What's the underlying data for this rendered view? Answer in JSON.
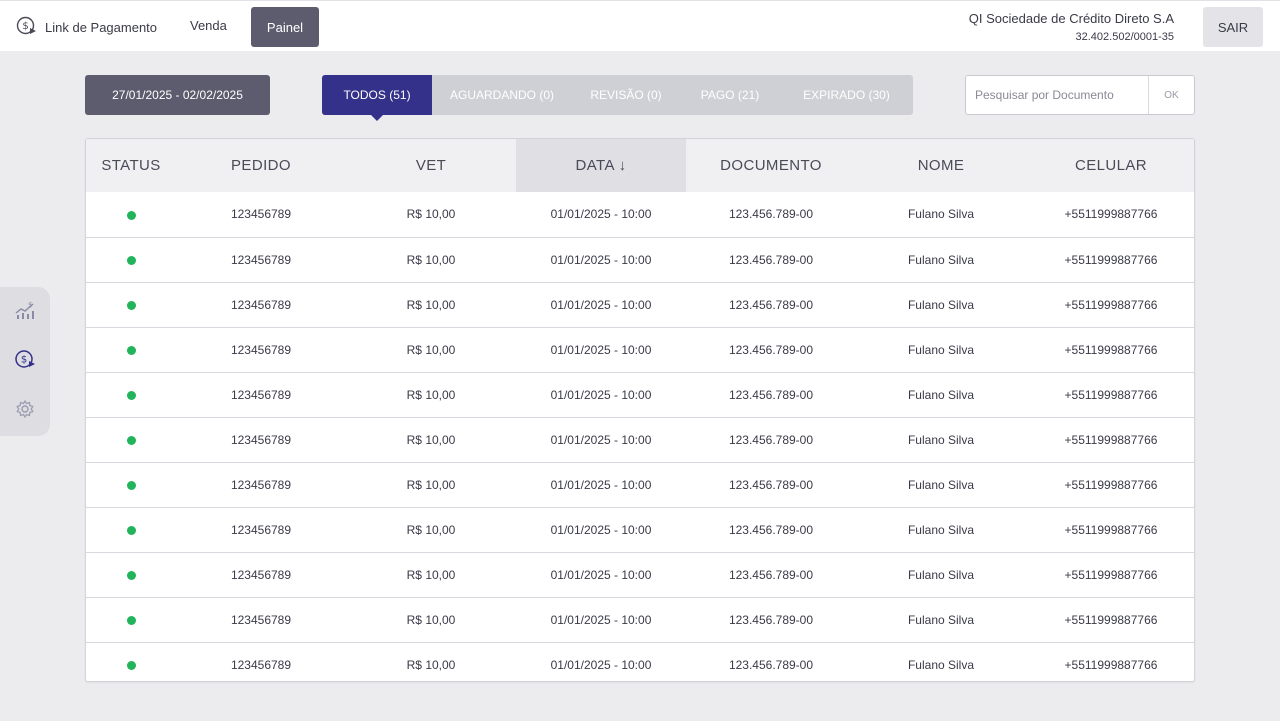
{
  "header": {
    "brand_label": "Link de Pagamento",
    "brand_icon": "dollar-send-icon",
    "nav_venda": "Venda",
    "nav_painel": "Painel",
    "company_name": "QI Sociedade de Crédito Direto S.A",
    "company_cnpj": "32.402.502/0001-35",
    "logout_label": "SAIR"
  },
  "siderail": {
    "items": [
      {
        "icon": "chart-dollar-icon"
      },
      {
        "icon": "dollar-send-icon"
      },
      {
        "icon": "gear-icon"
      }
    ]
  },
  "toolbar": {
    "date_range": "27/01/2025 - 02/02/2025",
    "filters": [
      {
        "label": "TODOS (51)",
        "active": true
      },
      {
        "label": "AGUARDANDO (0)",
        "active": false
      },
      {
        "label": "REVISÃO (0)",
        "active": false
      },
      {
        "label": "PAGO (21)",
        "active": false
      },
      {
        "label": "EXPIRADO (30)",
        "active": false
      }
    ],
    "search_placeholder": "Pesquisar por Documento",
    "search_button": "OK"
  },
  "table": {
    "columns": [
      "STATUS",
      "PEDIDO",
      "VET",
      "DATA ↓",
      "DOCUMENTO",
      "NOME",
      "CELULAR"
    ],
    "status_color": "#22b45a",
    "rows": [
      {
        "pedido": "123456789",
        "vet": "R$ 10,00",
        "data": "01/01/2025 - 10:00",
        "documento": "123.456.789-00",
        "nome": "Fulano Silva",
        "celular": "+5511999887766"
      },
      {
        "pedido": "123456789",
        "vet": "R$ 10,00",
        "data": "01/01/2025 - 10:00",
        "documento": "123.456.789-00",
        "nome": "Fulano Silva",
        "celular": "+5511999887766"
      },
      {
        "pedido": "123456789",
        "vet": "R$ 10,00",
        "data": "01/01/2025 - 10:00",
        "documento": "123.456.789-00",
        "nome": "Fulano Silva",
        "celular": "+5511999887766"
      },
      {
        "pedido": "123456789",
        "vet": "R$ 10,00",
        "data": "01/01/2025 - 10:00",
        "documento": "123.456.789-00",
        "nome": "Fulano Silva",
        "celular": "+5511999887766"
      },
      {
        "pedido": "123456789",
        "vet": "R$ 10,00",
        "data": "01/01/2025 - 10:00",
        "documento": "123.456.789-00",
        "nome": "Fulano Silva",
        "celular": "+5511999887766"
      },
      {
        "pedido": "123456789",
        "vet": "R$ 10,00",
        "data": "01/01/2025 - 10:00",
        "documento": "123.456.789-00",
        "nome": "Fulano Silva",
        "celular": "+5511999887766"
      },
      {
        "pedido": "123456789",
        "vet": "R$ 10,00",
        "data": "01/01/2025 - 10:00",
        "documento": "123.456.789-00",
        "nome": "Fulano Silva",
        "celular": "+5511999887766"
      },
      {
        "pedido": "123456789",
        "vet": "R$ 10,00",
        "data": "01/01/2025 - 10:00",
        "documento": "123.456.789-00",
        "nome": "Fulano Silva",
        "celular": "+5511999887766"
      },
      {
        "pedido": "123456789",
        "vet": "R$ 10,00",
        "data": "01/01/2025 - 10:00",
        "documento": "123.456.789-00",
        "nome": "Fulano Silva",
        "celular": "+5511999887766"
      },
      {
        "pedido": "123456789",
        "vet": "R$ 10,00",
        "data": "01/01/2025 - 10:00",
        "documento": "123.456.789-00",
        "nome": "Fulano Silva",
        "celular": "+5511999887766"
      },
      {
        "pedido": "123456789",
        "vet": "R$ 10,00",
        "data": "01/01/2025 - 10:00",
        "documento": "123.456.789-00",
        "nome": "Fulano Silva",
        "celular": "+5511999887766"
      }
    ]
  }
}
